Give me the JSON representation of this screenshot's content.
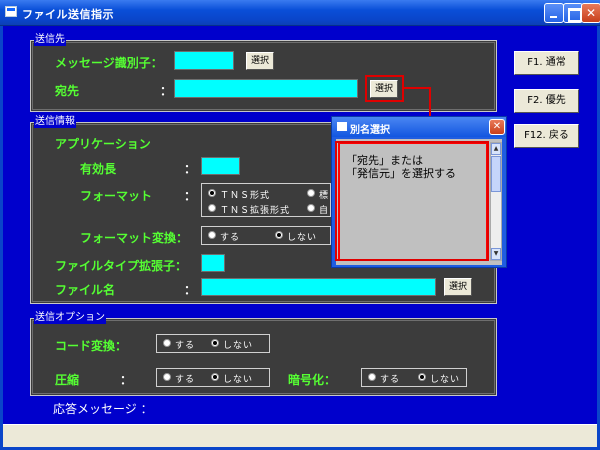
{
  "window": {
    "title": "ファイル送信指示"
  },
  "destination_group": {
    "label": "送信先",
    "message_id_label": "メッセージ識別子：",
    "message_id_value": "",
    "select_label_1": "選択",
    "address_label": "宛先",
    "address_colon": "：",
    "address_value": "",
    "select_label_2": "選択"
  },
  "info_group": {
    "label": "送信情報",
    "application_label": "アプリケーション",
    "valid_length_label": "有効長",
    "valid_length_value": "",
    "format_label": "フォーマット",
    "format_options": [
      "ＴＮＳ形式",
      "ＴＮＳ拡張形式",
      "標",
      "自"
    ],
    "format_selected": "ＴＮＳ形式",
    "format_convert_label": "フォーマット変換：",
    "format_convert_options": [
      "する",
      "しない"
    ],
    "format_convert_selected": "しない",
    "filetype_ext_label": "ファイルタイプ拡張子：",
    "filetype_ext_value": "",
    "filename_label": "ファイル名",
    "filename_value": "",
    "select_label": "選択",
    "colon": "："
  },
  "options_group": {
    "label": "送信オプション",
    "code_convert_label": "コード変換：",
    "code_convert_options": [
      "する",
      "しない"
    ],
    "code_convert_selected": "しない",
    "compress_label": "圧縮",
    "compress_colon": "：",
    "compress_options": [
      "する",
      "しない"
    ],
    "compress_selected": "しない",
    "encrypt_label": "暗号化：",
    "encrypt_options": [
      "する",
      "しない"
    ],
    "encrypt_selected": "しない"
  },
  "response_label": "応答メッセージ ：",
  "side_buttons": {
    "f1": "F1. 通常",
    "f2": "F2. 優先",
    "f12": "F12. 戻る"
  },
  "popup": {
    "title": "別名選択",
    "content": "「宛先」または\n「発信元」を選択する"
  },
  "colors": {
    "background": "#0000cc",
    "label_green": "#55ff33",
    "field_cyan": "#00ffff",
    "annotation_red": "#e00000"
  }
}
